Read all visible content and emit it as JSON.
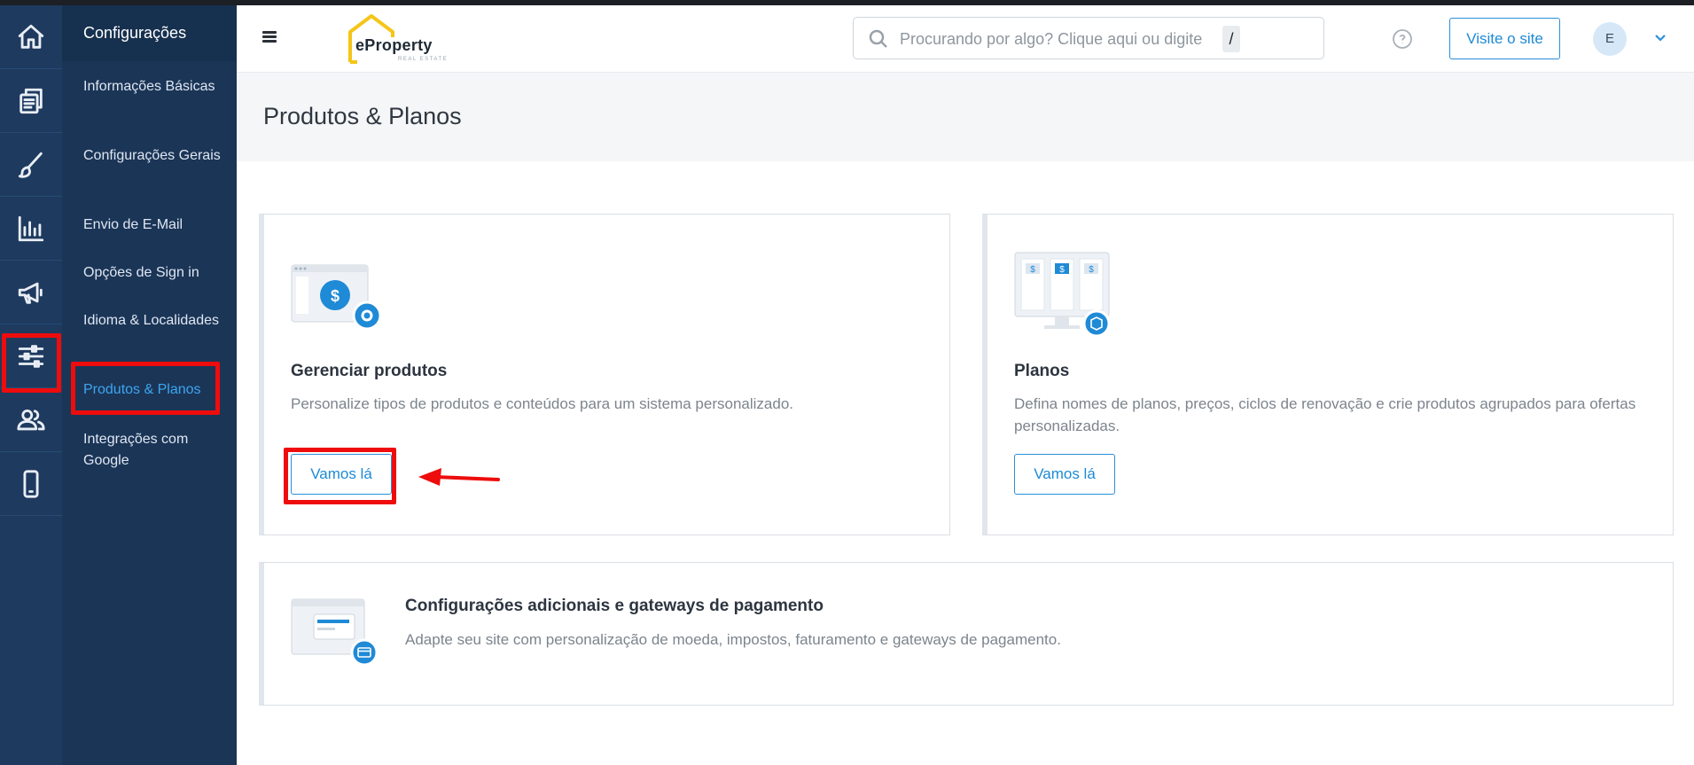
{
  "sidebar_rail": {
    "items": [
      {
        "icon": "home-icon"
      },
      {
        "icon": "pages-icon"
      },
      {
        "icon": "brush-icon"
      },
      {
        "icon": "analytics-icon"
      },
      {
        "icon": "megaphone-icon"
      },
      {
        "icon": "settings-sliders-icon"
      },
      {
        "icon": "users-icon"
      },
      {
        "icon": "mobile-icon"
      }
    ]
  },
  "settings_panel": {
    "title": "Configurações",
    "items": [
      {
        "label": "Informações Básicas"
      },
      {
        "label": "Configurações Gerais"
      },
      {
        "label": "Envio de E-Mail"
      },
      {
        "label": "Opções de Sign in"
      },
      {
        "label": "Idioma & Localidades"
      },
      {
        "label": "Produtos & Planos",
        "active": true
      },
      {
        "label": "Integrações com Google"
      }
    ]
  },
  "topbar": {
    "logo_text": "eProperty",
    "logo_sub": "REAL ESTATE",
    "search_placeholder": "Procurando por algo? Clique aqui ou digite",
    "search_shortcut": "/",
    "visit_label": "Visite o site",
    "avatar_initial": "E"
  },
  "page": {
    "title": "Produtos & Planos"
  },
  "cards": {
    "products": {
      "title": "Gerenciar produtos",
      "description": "Personalize tipos de produtos e conteúdos para um sistema personalizado.",
      "button": "Vamos lá"
    },
    "plans": {
      "title": "Planos",
      "description": "Defina nomes de planos, preços, ciclos de renovação e crie produtos agrupados para ofertas personalizadas.",
      "button": "Vamos lá"
    },
    "payments": {
      "title": "Configurações adicionais e gateways de pagamento",
      "description": "Adapte seu site com personalização de moeda, impostos, faturamento e gateways de pagamento."
    }
  },
  "colors": {
    "rail_bg": "#1e3a5f",
    "panel_bg": "#1b3557",
    "accent": "#2a8fd8",
    "annotation": "#ee0c0c"
  }
}
